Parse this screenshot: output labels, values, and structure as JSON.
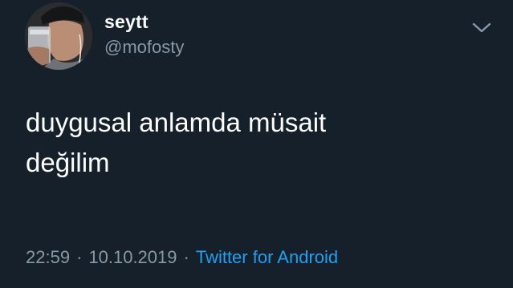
{
  "tweet": {
    "author": {
      "display_name": "seytt",
      "handle": "@mofosty",
      "avatar_icon": "profile-photo"
    },
    "menu_icon": "chevron-down-icon",
    "text_lines": [
      "duygusal anlamda müsait",
      "değilim"
    ],
    "meta": {
      "time": "22:59",
      "date": "10.10.2019",
      "separator": "·",
      "source": "Twitter for Android"
    }
  },
  "colors": {
    "background": "#15202b",
    "primary_text": "#ffffff",
    "secondary_text": "#8899a6",
    "link": "#1da1f2"
  }
}
